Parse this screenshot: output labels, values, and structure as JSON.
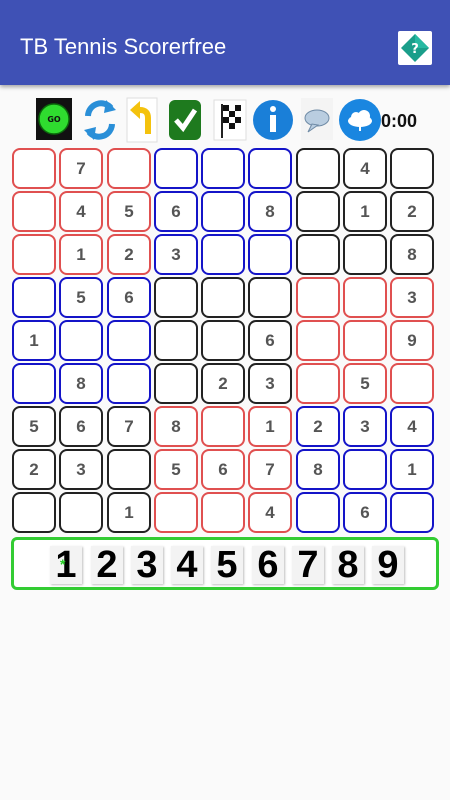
{
  "app": {
    "title": "TB Tennis Scorerfree",
    "help_icon": "question-diamond-icon"
  },
  "toolbar": {
    "go_label": "GO",
    "timer": "0:00",
    "buttons": [
      {
        "name": "go-button",
        "icon": "go-icon"
      },
      {
        "name": "refresh-button",
        "icon": "refresh-icon"
      },
      {
        "name": "undo-button",
        "icon": "undo-arrow-icon"
      },
      {
        "name": "check-button",
        "icon": "checkmark-icon"
      },
      {
        "name": "finish-flag-button",
        "icon": "checkered-flag-icon"
      },
      {
        "name": "info-button",
        "icon": "info-icon"
      },
      {
        "name": "hint-button",
        "icon": "speech-bubble-icon"
      },
      {
        "name": "cloud-button",
        "icon": "cloud-upload-icon"
      }
    ]
  },
  "board": {
    "rows": [
      [
        "",
        "7",
        "",
        "",
        "",
        "",
        "",
        "4",
        ""
      ],
      [
        "",
        "4",
        "5",
        "6",
        "",
        "8",
        "",
        "1",
        "2"
      ],
      [
        "",
        "1",
        "2",
        "3",
        "",
        "",
        "",
        "",
        "8"
      ],
      [
        "",
        "5",
        "6",
        "",
        "",
        "",
        "",
        "",
        "3"
      ],
      [
        "1",
        "",
        "",
        "",
        "",
        "6",
        "",
        "",
        "9"
      ],
      [
        "",
        "8",
        "",
        "",
        "2",
        "3",
        "",
        "5",
        ""
      ],
      [
        "5",
        "6",
        "7",
        "8",
        "",
        "1",
        "2",
        "3",
        "4"
      ],
      [
        "2",
        "3",
        "",
        "5",
        "6",
        "7",
        "8",
        "",
        "1"
      ],
      [
        "",
        "",
        "1",
        "",
        "",
        "4",
        "",
        "6",
        ""
      ]
    ],
    "box_colors": [
      [
        "red",
        "blue",
        "black"
      ],
      [
        "blue",
        "black",
        "red"
      ],
      [
        "black",
        "red",
        "blue"
      ]
    ],
    "colors": {
      "red": "#e05050",
      "blue": "#1414c8",
      "black": "#222222"
    }
  },
  "numpad": {
    "keys": [
      "1",
      "2",
      "3",
      "4",
      "5",
      "6",
      "7",
      "8",
      "9"
    ],
    "selected_marker": "*",
    "border_color": "#33cc33"
  }
}
